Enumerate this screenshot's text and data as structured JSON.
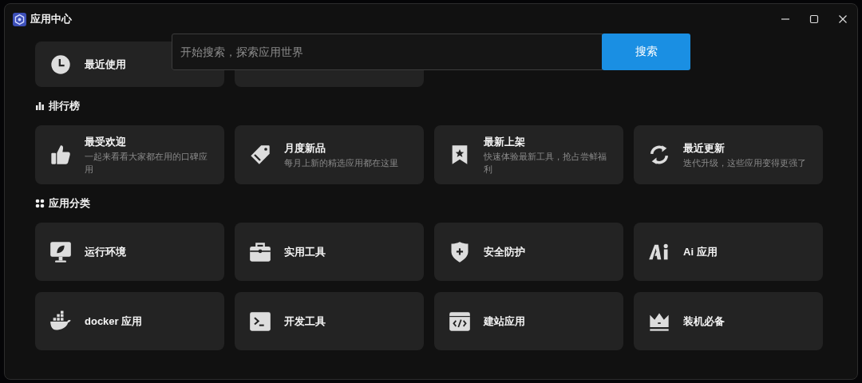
{
  "window": {
    "title": "应用中心"
  },
  "search": {
    "placeholder": "开始搜索，探索应用世界",
    "button": "搜索"
  },
  "quick": [
    {
      "kind": "labeled",
      "label": "最近使用"
    },
    {
      "kind": "covered"
    }
  ],
  "ranking": {
    "title": "排行榜",
    "items": [
      {
        "title": "最受欢迎",
        "desc": "一起来看看大家都在用的口碑应用"
      },
      {
        "title": "月度新品",
        "desc": "每月上新的精选应用都在这里"
      },
      {
        "title": "最新上架",
        "desc": "快速体验最新工具，抢占尝鲜福利"
      },
      {
        "title": "最近更新",
        "desc": "迭代升级，这些应用变得更强了"
      }
    ]
  },
  "categories": {
    "title": "应用分类",
    "items": [
      {
        "label": "运行环境"
      },
      {
        "label": "实用工具"
      },
      {
        "label": "安全防护"
      },
      {
        "label": "Ai 应用"
      },
      {
        "label": "docker 应用"
      },
      {
        "label": "开发工具"
      },
      {
        "label": "建站应用"
      },
      {
        "label": "装机必备"
      }
    ]
  }
}
